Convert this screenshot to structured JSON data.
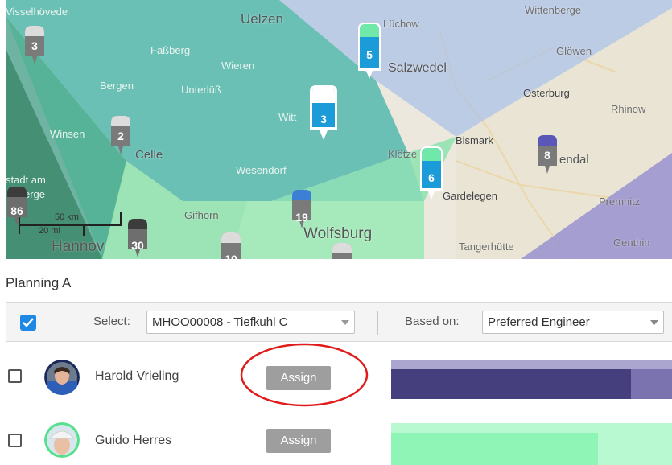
{
  "map": {
    "places": [
      {
        "id": "visselhovede",
        "label": "Visselhövede"
      },
      {
        "id": "uelzen",
        "label": "Uelzen"
      },
      {
        "id": "luchow",
        "label": "Lüchow"
      },
      {
        "id": "wittenberge",
        "label": "Wittenberge"
      },
      {
        "id": "fassberg",
        "label": "Faßberg"
      },
      {
        "id": "wieren",
        "label": "Wieren"
      },
      {
        "id": "salzwedel",
        "label": "Salzwedel"
      },
      {
        "id": "glowen",
        "label": "Glöwen"
      },
      {
        "id": "bergen",
        "label": "Bergen"
      },
      {
        "id": "unterluss",
        "label": "Unterlüß"
      },
      {
        "id": "osterburg",
        "label": "Osterburg"
      },
      {
        "id": "rhinow",
        "label": "Rhinow"
      },
      {
        "id": "winsen",
        "label": "Winsen"
      },
      {
        "id": "witt",
        "label": "Witt"
      },
      {
        "id": "celle",
        "label": "Celle"
      },
      {
        "id": "klotze",
        "label": "Klötze"
      },
      {
        "id": "bismark",
        "label": "Bismark"
      },
      {
        "id": "endal",
        "label": "endal"
      },
      {
        "id": "wesendorf",
        "label": "Wesendorf"
      },
      {
        "id": "stadt-am",
        "label": "stadt am"
      },
      {
        "id": "gardelegen",
        "label": "Gardelegen"
      },
      {
        "id": "erge",
        "label": "erge"
      },
      {
        "id": "premnitz",
        "label": "Premnitz"
      },
      {
        "id": "gifhorn",
        "label": "Gifhorn"
      },
      {
        "id": "wolfsburg",
        "label": "Wolfsburg"
      },
      {
        "id": "hannover",
        "label": "Hannov"
      },
      {
        "id": "tangerhutte",
        "label": "Tangerhütte"
      },
      {
        "id": "genthin",
        "label": "Genthin"
      }
    ],
    "pins": [
      {
        "id": "pin-3a",
        "label": "3"
      },
      {
        "id": "pin-5",
        "label": "5"
      },
      {
        "id": "pin-3b",
        "label": "3"
      },
      {
        "id": "pin-2",
        "label": "2"
      },
      {
        "id": "pin-8",
        "label": "8"
      },
      {
        "id": "pin-6",
        "label": "6"
      },
      {
        "id": "pin-86",
        "label": "86"
      },
      {
        "id": "pin-19",
        "label": "19"
      },
      {
        "id": "pin-30",
        "label": "30"
      },
      {
        "id": "pin-10",
        "label": "10"
      }
    ],
    "scale": {
      "km": "50 km",
      "mi": "20 mi"
    }
  },
  "planning": {
    "title": "Planning A",
    "toolbar": {
      "select_label": "Select:",
      "select_value": "MHOO00008 - Tiefkuhl C",
      "based_on_label": "Based on:",
      "based_on_value": "Preferred Engineer",
      "select_all_checked": true
    },
    "engineers": [
      {
        "name": "Harold Vrieling",
        "assign_label": "Assign",
        "checked": false,
        "bar_color": "#453f7d",
        "bar_light": "#aaa6cf"
      },
      {
        "name": "Guido Herres",
        "assign_label": "Assign",
        "checked": false,
        "bar_color": "#8ef5b6",
        "bar_light": "#b9f9d2"
      }
    ]
  },
  "colors": {
    "accent": "#1e88e5",
    "annotation": "#e01b1b"
  }
}
